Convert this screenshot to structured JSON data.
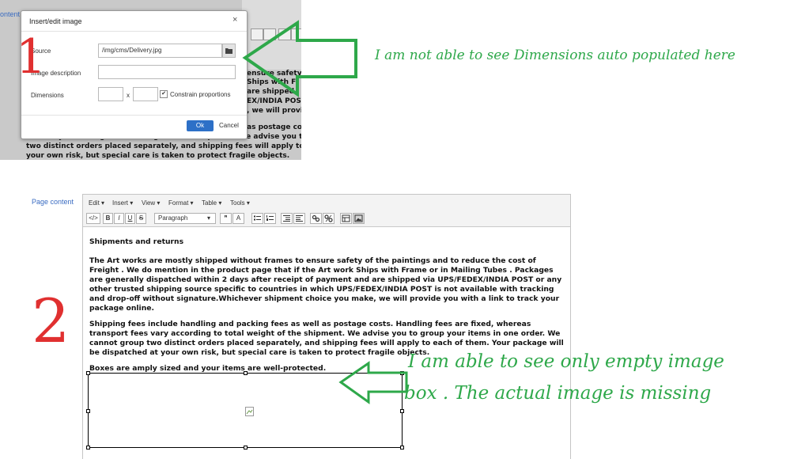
{
  "top_screenshot": {
    "background_label": "ontent",
    "background_lines": [
      "ensure safety of",
      "Ships with F",
      "are shipped",
      "EX/INDIA POST",
      ", we will provi",
      "as postage cos",
      "fees vary according to total weight of the shipment. We advise you to",
      "two distinct orders placed separately, and shipping fees will apply to",
      "your own risk, but special care is taken to protect fragile objects."
    ],
    "dialog": {
      "title": "Insert/edit image",
      "close_glyph": "×",
      "source_label": "Source",
      "source_value": "/img/cms/Delivery.jpg",
      "description_label": "Image description",
      "description_value": "",
      "dimensions_label": "Dimensions",
      "width_value": "",
      "height_value": "",
      "times_sign": "x",
      "constrain_label": "Constrain proportions",
      "constrain_checked": "✔",
      "ok_label": "Ok",
      "cancel_label": "Cancel"
    }
  },
  "annotations": {
    "marker_one": "1",
    "marker_two": "2",
    "note_one": "I am not able to see Dimensions auto populated here",
    "note_two_line1": "I am able to see only empty image",
    "note_two_line2": "box . The actual image is missing",
    "green": "#2ea84a",
    "red": "#e03030"
  },
  "bottom_screenshot": {
    "page_content_label": "Page content",
    "menubar": [
      "Edit ▾",
      "Insert ▾",
      "View ▾",
      "Format ▾",
      "Table ▾",
      "Tools ▾"
    ],
    "toolbar": {
      "source_code": "</>",
      "bold": "B",
      "italic": "I",
      "underline": "U",
      "strikethrough": "S",
      "format_value": "Paragraph",
      "blockquote": "❞",
      "text_color": "A"
    },
    "content": {
      "heading": "Shipments and returns",
      "para1": "The Art works are mostly shipped without frames to ensure safety of the paintings and to reduce the cost of Freight . We do mention in the product page that if the Art work Ships with Frame or in Mailing Tubes . Packages are generally dispatched within 2 days after receipt of payment and are shipped via UPS/FEDEX/INDIA POST or any other trusted shipping source specific to countries in which UPS/FEDEX/INDIA POST is not available with tracking and drop-off without signature.Whichever shipment choice you make, we will provide you with a link to track your package online.",
      "para2": "Shipping fees include handling and packing fees as well as postage costs. Handling fees are fixed, whereas transport fees vary according to total weight of the shipment. We advise you to group your items in one order. We cannot group two distinct orders placed separately, and shipping fees will apply to each of them. Your package will be dispatched at your own risk, but special care is taken to protect fragile objects.",
      "para3": "Boxes are amply sized and your items are well-protected."
    }
  }
}
